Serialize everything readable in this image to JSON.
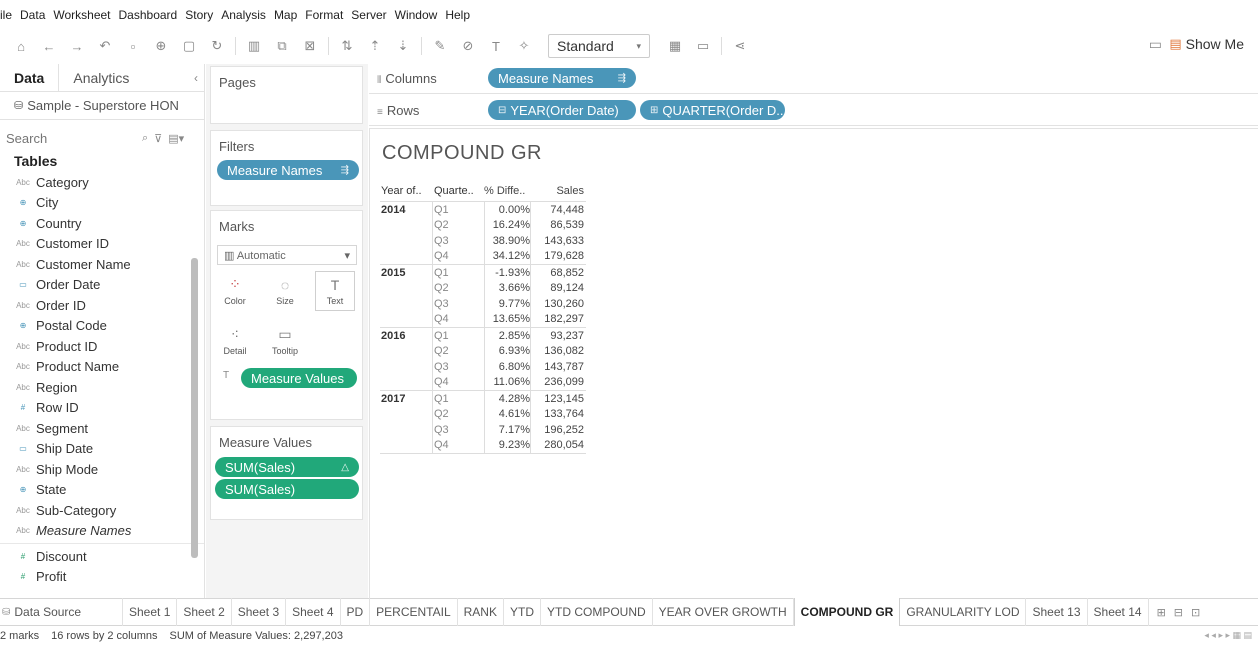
{
  "menu": [
    "ile",
    "Data",
    "Worksheet",
    "Dashboard",
    "Story",
    "Analysis",
    "Map",
    "Format",
    "Server",
    "Window",
    "Help"
  ],
  "toolbar": {
    "view_size": "Standard",
    "show_me": "Show Me"
  },
  "left": {
    "tab_data": "Data",
    "tab_analytics": "Analytics",
    "datasource": "Sample - Superstore HON",
    "search_placeholder": "Search",
    "tables_header": "Tables",
    "dimensions": [
      {
        "icon": "Abc",
        "name": "Category"
      },
      {
        "icon": "globe",
        "name": "City"
      },
      {
        "icon": "globe",
        "name": "Country"
      },
      {
        "icon": "Abc",
        "name": "Customer ID"
      },
      {
        "icon": "Abc",
        "name": "Customer Name"
      },
      {
        "icon": "calendar",
        "name": "Order Date"
      },
      {
        "icon": "Abc",
        "name": "Order ID"
      },
      {
        "icon": "globe",
        "name": "Postal Code"
      },
      {
        "icon": "Abc",
        "name": "Product ID"
      },
      {
        "icon": "Abc",
        "name": "Product Name"
      },
      {
        "icon": "Abc",
        "name": "Region"
      },
      {
        "icon": "#",
        "name": "Row ID"
      },
      {
        "icon": "Abc",
        "name": "Segment"
      },
      {
        "icon": "calendar",
        "name": "Ship Date"
      },
      {
        "icon": "Abc",
        "name": "Ship Mode"
      },
      {
        "icon": "globe",
        "name": "State"
      },
      {
        "icon": "Abc",
        "name": "Sub-Category"
      },
      {
        "icon": "Abc",
        "name": "Measure Names",
        "italic": true
      }
    ],
    "measures": [
      {
        "icon": "#",
        "name": "Discount"
      },
      {
        "icon": "#",
        "name": "Profit"
      }
    ]
  },
  "cards": {
    "pages": "Pages",
    "filters": "Filters",
    "filter_pill": "Measure Names",
    "marks": "Marks",
    "marks_type": "Automatic",
    "mark_buttons": [
      "Color",
      "Size",
      "Text",
      "Detail",
      "Tooltip"
    ],
    "marks_pill": "Measure Values",
    "measure_values": "Measure Values",
    "mv_pills": [
      "SUM(Sales)",
      "SUM(Sales)"
    ]
  },
  "shelves": {
    "columns_label": "Columns",
    "columns_pill": "Measure Names",
    "rows_label": "Rows",
    "rows_pills": [
      "YEAR(Order Date)",
      "QUARTER(Order D.."
    ]
  },
  "viz": {
    "title": "COMPOUND GR",
    "headers": [
      "Year of..",
      "Quarte..",
      "% Diffe..",
      "Sales"
    ],
    "years": [
      {
        "year": "2014",
        "rows": [
          {
            "q": "Q1",
            "pct": "0.00%",
            "sales": "74,448"
          },
          {
            "q": "Q2",
            "pct": "16.24%",
            "sales": "86,539"
          },
          {
            "q": "Q3",
            "pct": "38.90%",
            "sales": "143,633"
          },
          {
            "q": "Q4",
            "pct": "34.12%",
            "sales": "179,628"
          }
        ]
      },
      {
        "year": "2015",
        "rows": [
          {
            "q": "Q1",
            "pct": "-1.93%",
            "sales": "68,852"
          },
          {
            "q": "Q2",
            "pct": "3.66%",
            "sales": "89,124"
          },
          {
            "q": "Q3",
            "pct": "9.77%",
            "sales": "130,260"
          },
          {
            "q": "Q4",
            "pct": "13.65%",
            "sales": "182,297"
          }
        ]
      },
      {
        "year": "2016",
        "rows": [
          {
            "q": "Q1",
            "pct": "2.85%",
            "sales": "93,237"
          },
          {
            "q": "Q2",
            "pct": "6.93%",
            "sales": "136,082"
          },
          {
            "q": "Q3",
            "pct": "6.80%",
            "sales": "143,787"
          },
          {
            "q": "Q4",
            "pct": "11.06%",
            "sales": "236,099"
          }
        ]
      },
      {
        "year": "2017",
        "rows": [
          {
            "q": "Q1",
            "pct": "4.28%",
            "sales": "123,145"
          },
          {
            "q": "Q2",
            "pct": "4.61%",
            "sales": "133,764"
          },
          {
            "q": "Q3",
            "pct": "7.17%",
            "sales": "196,252"
          },
          {
            "q": "Q4",
            "pct": "9.23%",
            "sales": "280,054"
          }
        ]
      }
    ]
  },
  "sheets": {
    "data_source": "Data Source",
    "tabs": [
      "Sheet 1",
      "Sheet 2",
      "Sheet 3",
      "Sheet 4",
      "PD",
      "PERCENTAIL",
      "RANK",
      "YTD",
      "YTD COMPOUND",
      "YEAR OVER GROWTH",
      "COMPOUND GR",
      "GRANULARITY LOD",
      "Sheet 13",
      "Sheet 14"
    ],
    "active": "COMPOUND GR"
  },
  "status": {
    "marks": "2 marks",
    "dims": "16 rows by 2 columns",
    "sum": "SUM of Measure Values: 2,297,203"
  },
  "colors": {
    "dimension_pill": "#4a96b9",
    "measure_pill": "#21a87a"
  }
}
